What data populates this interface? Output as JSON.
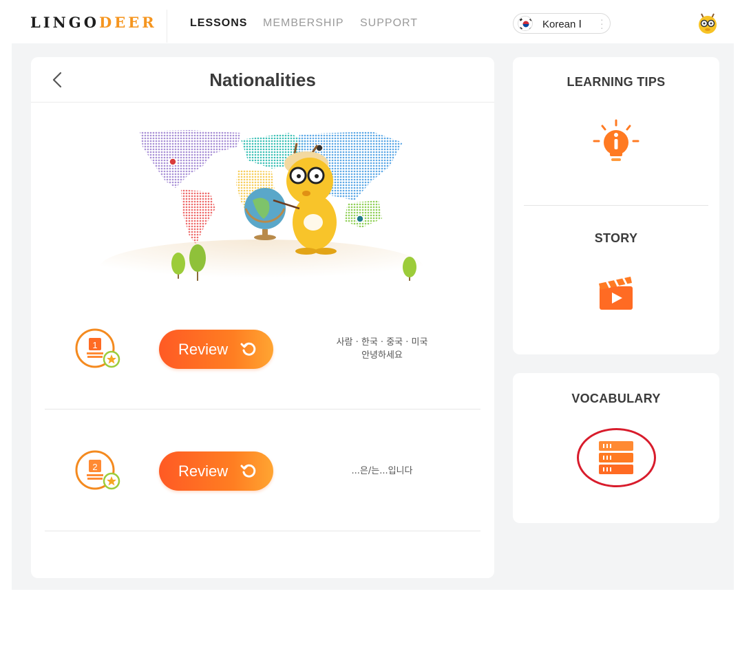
{
  "brand": {
    "logo_main": "LINGO",
    "logo_accent": "DEER"
  },
  "nav": {
    "lessons": "LESSONS",
    "membership": "MEMBERSHIP",
    "support": "SUPPORT"
  },
  "language": {
    "label": "Korean Ⅰ",
    "flag_icon": "korea-flag-icon"
  },
  "lesson": {
    "title": "Nationalities",
    "rows": [
      {
        "number": "1",
        "button_label": "Review",
        "description_line1": "사람 · 한국 · 중국 · 미국",
        "description_line2": "안녕하세요"
      },
      {
        "number": "2",
        "button_label": "Review",
        "description_line1": "...은/는...입니다",
        "description_line2": ""
      }
    ]
  },
  "sidebar": {
    "learning_tips": "LEARNING TIPS",
    "story": "STORY",
    "vocabulary": "VOCABULARY"
  },
  "colors": {
    "accent": "#ff7a22",
    "highlight_ring": "#d81c2c",
    "background": "#f3f4f5"
  }
}
